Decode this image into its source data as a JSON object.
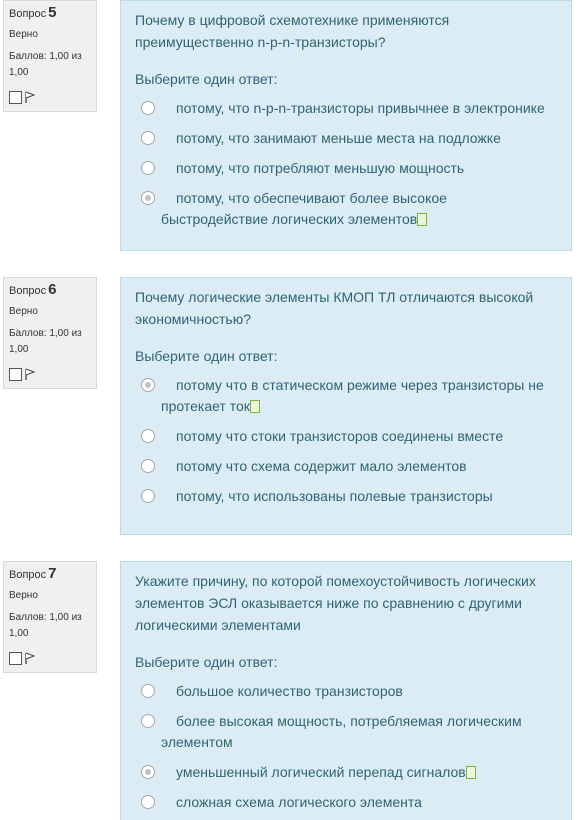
{
  "questions": [
    {
      "label": "Вопрос",
      "number": "5",
      "state": "Верно",
      "grade_line1": "Баллов: 1,00 из",
      "grade_line2": "1,00",
      "text": "Почему в цифровой схемотехнике применяются преимущественно n-p-n-транзисторы?",
      "prompt": "Выберите один ответ:",
      "options": [
        "потому, что n-p-n-транзисторы привычнее в электронике",
        "потому, что занимают меньше места на подложке",
        "потому, что потребляют меньшую мощность",
        "потому, что обеспечивают более высокое быстродействие логических элементов"
      ],
      "selected_index": 3
    },
    {
      "label": "Вопрос",
      "number": "6",
      "state": "Верно",
      "grade_line1": "Баллов: 1,00 из",
      "grade_line2": "1,00",
      "text": "Почему логические элементы КМОП ТЛ отличаются высокой экономичностью?",
      "prompt": "Выберите один ответ:",
      "options": [
        "потому что в статическом режиме через транзисторы не протекает ток",
        "потому что стоки транзисторов соединены вместе",
        "потому что схема содержит мало элементов",
        "потому, что использованы полевые транзисторы"
      ],
      "selected_index": 0
    },
    {
      "label": "Вопрос",
      "number": "7",
      "state": "Верно",
      "grade_line1": "Баллов: 1,00 из",
      "grade_line2": "1,00",
      "text": "Укажите причину, по которой помехоустойчивость логических элементов ЭСЛ оказывается ниже по сравнению с другими логическими элементами",
      "prompt": "Выберите один ответ:",
      "options": [
        "большое количество транзисторов",
        "более высокая мощность, потребляемая логическим элементом",
        "уменьшенный логический перепад сигналов",
        "сложная схема логического элемента"
      ],
      "selected_index": 2
    }
  ],
  "icons": {
    "flag": "flag-icon",
    "correct": "correct-mark-icon"
  },
  "colors": {
    "info_bg": "#f0f0f0",
    "content_bg": "#dcecf5",
    "text": "#2f6473"
  }
}
